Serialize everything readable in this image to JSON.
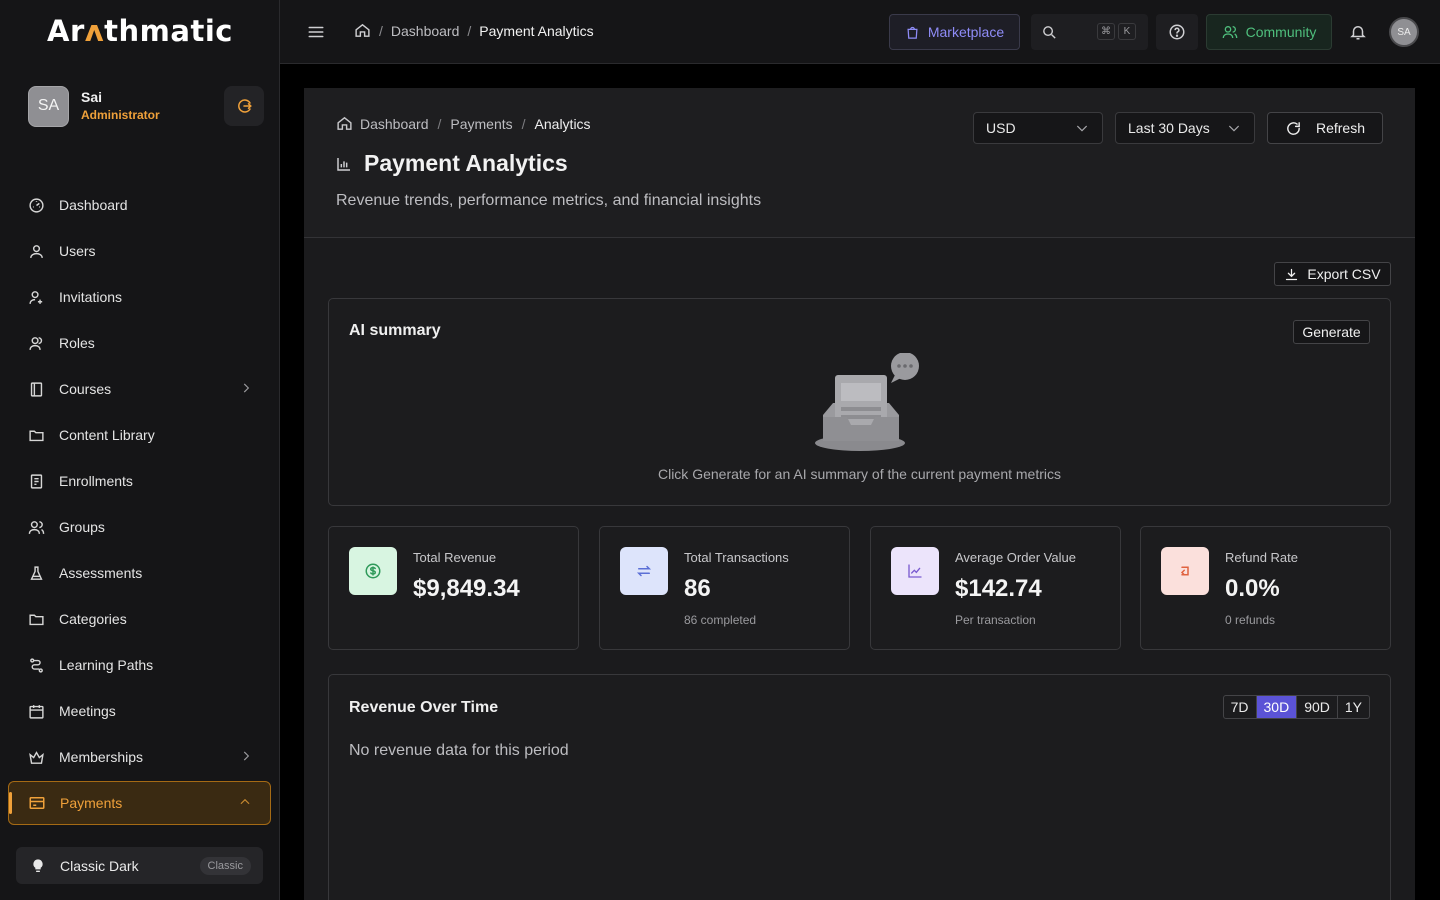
{
  "app": {
    "logo_pre": "Ar",
    "logo_mid": "ʌ",
    "logo_post": "thmatic"
  },
  "user": {
    "initials": "SA",
    "name": "Sai",
    "role": "Administrator"
  },
  "sidebar": {
    "items": [
      {
        "label": "Dashboard",
        "icon": "dashboard-icon"
      },
      {
        "label": "Users",
        "icon": "user-icon"
      },
      {
        "label": "Invitations",
        "icon": "user-plus-icon"
      },
      {
        "label": "Roles",
        "icon": "roles-icon"
      },
      {
        "label": "Courses",
        "icon": "book-icon",
        "expandable": true
      },
      {
        "label": "Content Library",
        "icon": "folder-icon"
      },
      {
        "label": "Enrollments",
        "icon": "clipboard-icon"
      },
      {
        "label": "Groups",
        "icon": "users-icon"
      },
      {
        "label": "Assessments",
        "icon": "flask-icon"
      },
      {
        "label": "Categories",
        "icon": "folder-icon"
      },
      {
        "label": "Learning Paths",
        "icon": "route-icon"
      },
      {
        "label": "Meetings",
        "icon": "calendar-icon"
      },
      {
        "label": "Memberships",
        "icon": "crown-icon",
        "expandable": true
      },
      {
        "label": "Payments",
        "icon": "credit-card-icon",
        "active": true
      }
    ],
    "theme_label": "Classic Dark",
    "theme_badge": "Classic"
  },
  "topbar": {
    "crumbs": [
      "Dashboard",
      "Payment Analytics"
    ],
    "marketplace": "Marketplace",
    "kbd_cmd": "⌘",
    "kbd_k": "K",
    "community": "Community",
    "avatar": "SA"
  },
  "page": {
    "crumbs": [
      "Dashboard",
      "Payments",
      "Analytics"
    ],
    "title": "Payment Analytics",
    "subtitle": "Revenue trends, performance metrics, and financial insights",
    "currency": "USD",
    "range": "Last 30 Days",
    "refresh": "Refresh",
    "export": "Export CSV"
  },
  "ai_summary": {
    "title": "AI summary",
    "generate": "Generate",
    "hint": "Click Generate for an AI summary of the current payment metrics"
  },
  "metrics": [
    {
      "label": "Total Revenue",
      "value": "$9,849.34",
      "sub": "",
      "icon": "dollar-icon",
      "bg": "#d8f5e1",
      "fg": "#2f9a5a"
    },
    {
      "label": "Total Transactions",
      "value": "86",
      "sub": "86 completed",
      "icon": "transfer-icon",
      "bg": "#dde4fb",
      "fg": "#5b6fd6"
    },
    {
      "label": "Average Order Value",
      "value": "$142.74",
      "sub": "Per transaction",
      "icon": "trend-icon",
      "bg": "#ece4fb",
      "fg": "#7a5bd0"
    },
    {
      "label": "Refund Rate",
      "value": "0.0%",
      "sub": "0 refunds",
      "icon": "refund-icon",
      "bg": "#fbe0dc",
      "fg": "#e0623f"
    }
  ],
  "revenue": {
    "title": "Revenue Over Time",
    "ranges": [
      "7D",
      "30D",
      "90D",
      "1Y"
    ],
    "active_range": "30D",
    "empty": "No revenue data for this period"
  },
  "colors": {
    "accent": "#f0a13a",
    "marketplace": "#8f8cf7",
    "community": "#4fbf7d",
    "segment_active": "#5b53d6"
  }
}
